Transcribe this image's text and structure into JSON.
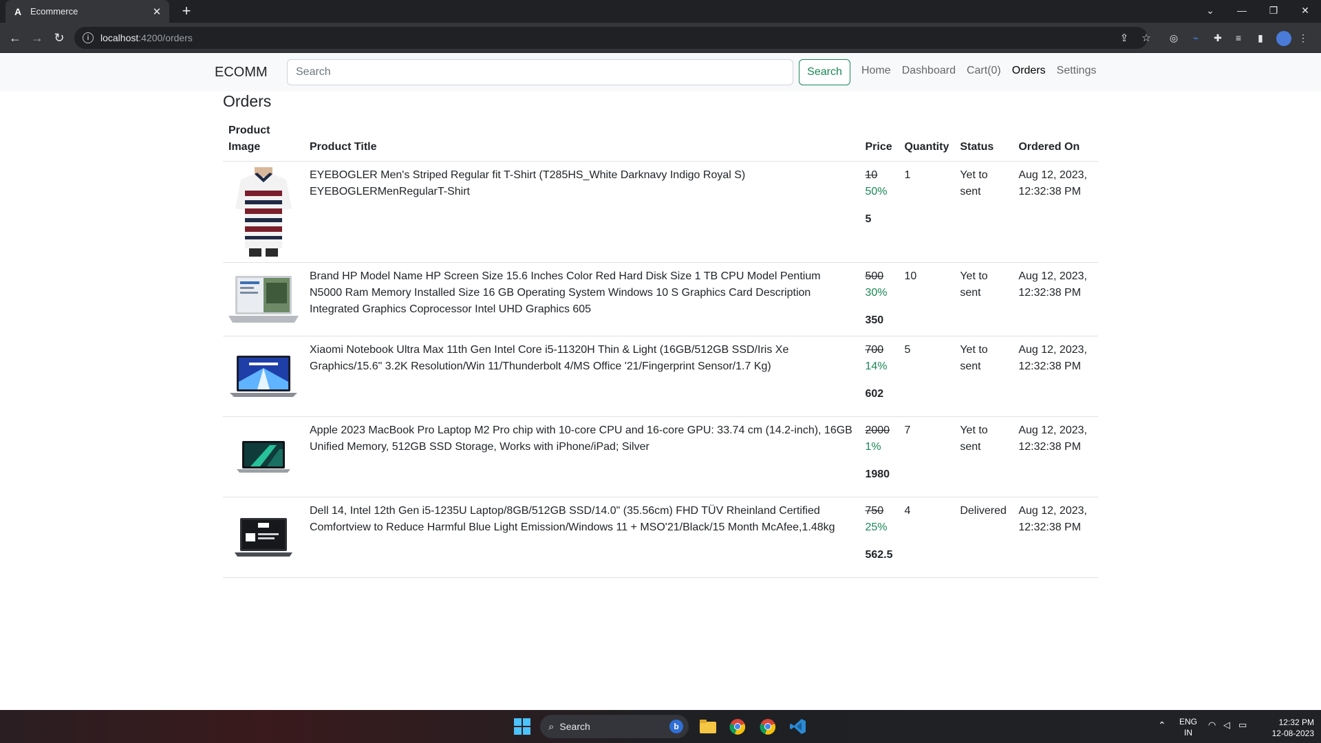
{
  "browser": {
    "tab_title": "Ecommerce",
    "favicon": "A",
    "url_host": "localhost",
    "url_path": ":4200/orders"
  },
  "navbar": {
    "brand": "ECOMM",
    "search_placeholder": "Search",
    "search_button": "Search",
    "links": [
      "Home",
      "Dashboard",
      "Cart(0)",
      "Orders",
      "Settings"
    ],
    "active_link": "Orders"
  },
  "page": {
    "title": "Orders",
    "columns": {
      "image_line1": "Product",
      "image_line2": "Image",
      "title": "Product Title",
      "price": "Price",
      "quantity": "Quantity",
      "status": "Status",
      "ordered_on": "Ordered On"
    },
    "orders": [
      {
        "title": "EYEBOGLER Men's Striped Regular fit T-Shirt (T285HS_White Darknavy Indigo Royal S) EYEBOGLERMenRegularT-Shirt",
        "price": "10",
        "discount": "50%",
        "final_price": "5",
        "quantity": "1",
        "status_line1": "Yet to",
        "status_line2": "sent",
        "date_line1": "Aug 12, 2023,",
        "date_line2": "12:32:38 PM",
        "image": "striped-tshirt"
      },
      {
        "title": "Brand HP Model Name HP Screen Size 15.6 Inches Color Red Hard Disk Size 1 TB CPU Model Pentium N5000 Ram Memory Installed Size 16 GB Operating System Windows 10 S Graphics Card Description Integrated Graphics Coprocessor Intel UHD Graphics 605",
        "price": "500",
        "discount": "30%",
        "final_price": "350",
        "quantity": "10",
        "status_line1": "Yet to",
        "status_line2": "sent",
        "date_line1": "Aug 12, 2023,",
        "date_line2": "12:32:38 PM",
        "image": "hp-laptop"
      },
      {
        "title": "Xiaomi Notebook Ultra Max 11th Gen Intel Core i5-11320H Thin & Light (16GB/512GB SSD/Iris Xe Graphics/15.6\" 3.2K Resolution/Win 11/Thunderbolt 4/MS Office '21/Fingerprint Sensor/1.7 Kg)",
        "price": "700",
        "discount": "14%",
        "final_price": "602",
        "quantity": "5",
        "status_line1": "Yet to",
        "status_line2": "sent",
        "date_line1": "Aug 12, 2023,",
        "date_line2": "12:32:38 PM",
        "image": "xiaomi-laptop"
      },
      {
        "title": "Apple 2023 MacBook Pro Laptop M2 Pro chip with 10-core CPU and 16-core GPU: 33.74 cm (14.2-inch), 16GB Unified Memory, 512GB SSD Storage, Works with iPhone/iPad; Silver",
        "price": "2000",
        "discount": "1%",
        "final_price": "1980",
        "quantity": "7",
        "status_line1": "Yet to",
        "status_line2": "sent",
        "date_line1": "Aug 12, 2023,",
        "date_line2": "12:32:38 PM",
        "image": "macbook-pro"
      },
      {
        "title": "Dell 14, Intel 12th Gen i5-1235U Laptop/8GB/512GB SSD/14.0\" (35.56cm) FHD TÜV Rheinland Certified Comfortview to Reduce Harmful Blue Light Emission/Windows 11 + MSO'21/Black/15 Month McAfee,1.48kg",
        "price": "750",
        "discount": "25%",
        "final_price": "562.5",
        "quantity": "4",
        "status_line1": "Delivered",
        "status_line2": "",
        "date_line1": "Aug 12, 2023,",
        "date_line2": "12:32:38 PM",
        "image": "dell-laptop"
      }
    ]
  },
  "taskbar": {
    "search_label": "Search",
    "lang_line1": "ENG",
    "lang_line2": "IN",
    "time": "12:32 PM",
    "date": "12-08-2023"
  },
  "colors": {
    "accent_green": "#198754",
    "chrome_dark": "#202124",
    "chrome_toolbar": "#35363a"
  }
}
